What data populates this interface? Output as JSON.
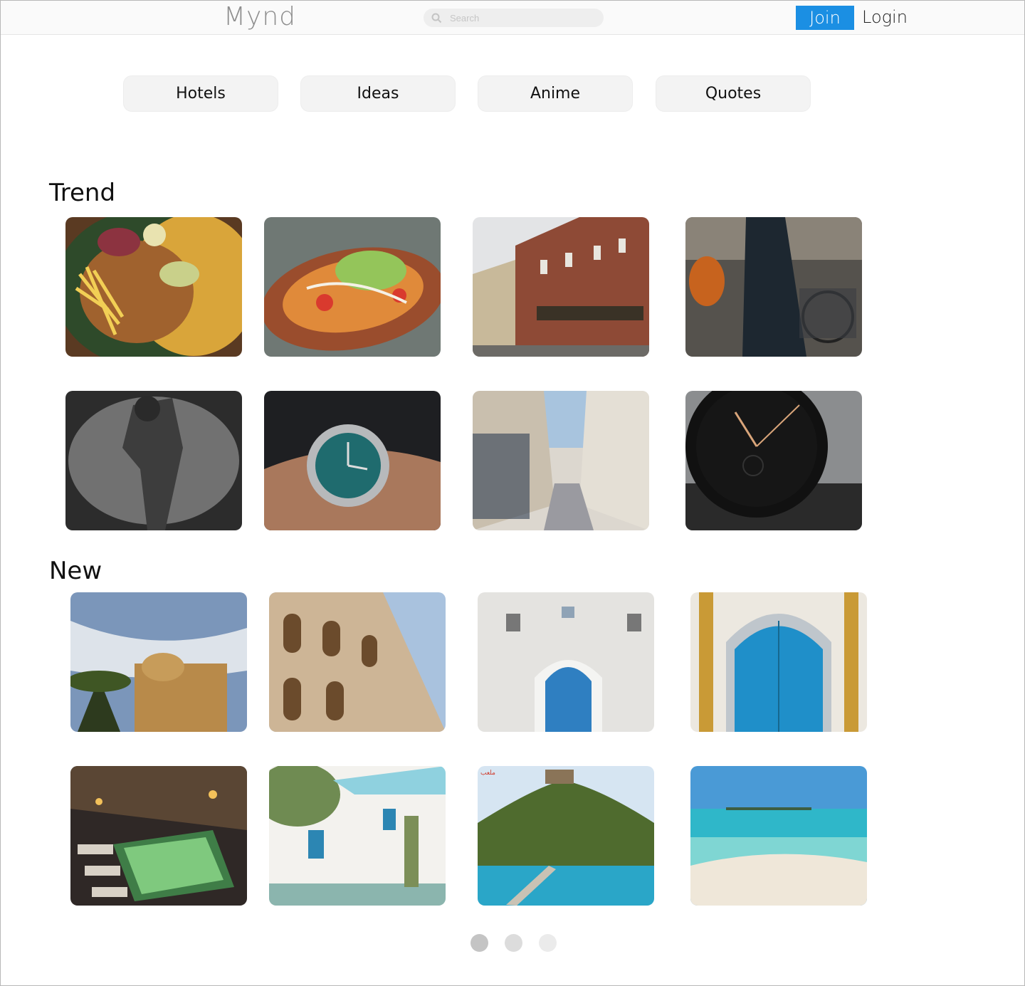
{
  "header": {
    "logo": "Mynd",
    "search_placeholder": "Search",
    "join_label": "Join",
    "login_label": "Login"
  },
  "categories": [
    "Hotels",
    "Ideas",
    "Anime",
    "Quotes"
  ],
  "sections": {
    "trend": {
      "title": "Trend",
      "images": [
        "food-plate-image",
        "stuffed-potato-image",
        "brick-street-image",
        "street-fashion-image",
        "athlete-image",
        "green-watch-image",
        "paris-street-image",
        "black-watch-image"
      ]
    },
    "new": {
      "title": "New",
      "images": [
        "desert-fort-image",
        "colosseum-image",
        "blue-door-wall-image",
        "ornate-blue-door-image",
        "lit-pool-courtyard-image",
        "white-house-pool-image",
        "hill-fortress-coast-image",
        "tropical-beach-image"
      ]
    }
  },
  "pagination": {
    "pages": 3,
    "active": 1
  },
  "colors": {
    "accent": "#1b8fe3",
    "dot_active": "#c4c4c4",
    "dot_inactive": "#dfdfdf"
  }
}
